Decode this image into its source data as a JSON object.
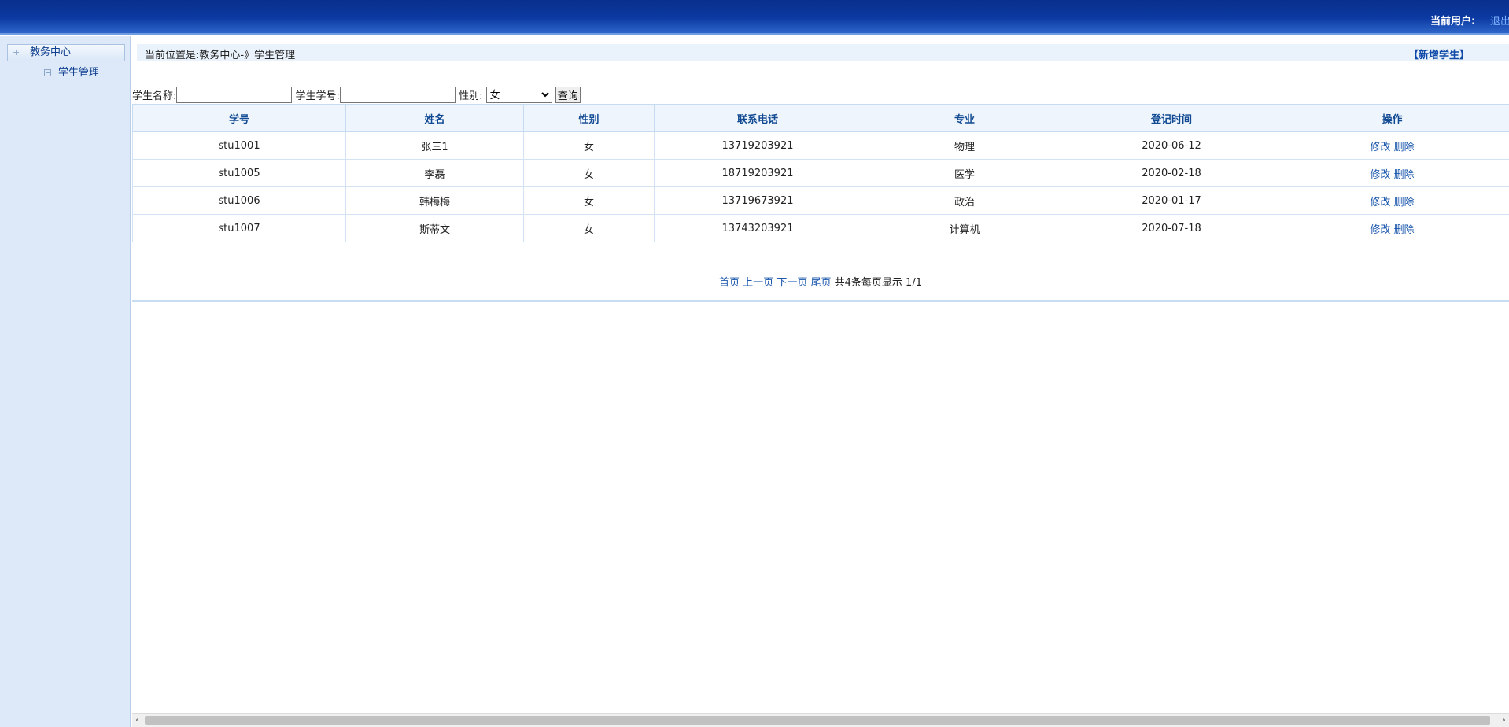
{
  "header": {
    "user_label": "当前用户:",
    "logout": "退出"
  },
  "sidebar": {
    "section": "教务中心",
    "items": [
      {
        "label": "学生管理"
      }
    ]
  },
  "breadcrumb": {
    "text": "当前位置是:教务中心-》学生管理",
    "new_link": "【新增学生】"
  },
  "search": {
    "name_label": "学生名称:",
    "name_value": "",
    "id_label": "学生学号:",
    "id_value": "",
    "gender_label": "性别:",
    "gender_selected": "女",
    "query_button": "查询"
  },
  "table": {
    "columns": [
      "学号",
      "姓名",
      "性别",
      "联系电话",
      "专业",
      "登记时间",
      "操作"
    ],
    "rows": [
      {
        "id": "stu1001",
        "name": "张三1",
        "gender": "女",
        "phone": "13719203921",
        "major": "物理",
        "date": "2020-06-12"
      },
      {
        "id": "stu1005",
        "name": "李磊",
        "gender": "女",
        "phone": "18719203921",
        "major": "医学",
        "date": "2020-02-18"
      },
      {
        "id": "stu1006",
        "name": "韩梅梅",
        "gender": "女",
        "phone": "13719673921",
        "major": "政治",
        "date": "2020-01-17"
      },
      {
        "id": "stu1007",
        "name": "斯蒂文",
        "gender": "女",
        "phone": "13743203921",
        "major": "计算机",
        "date": "2020-07-18"
      }
    ],
    "edit_label": "修改",
    "delete_label": "删除"
  },
  "pager": {
    "first": "首页",
    "prev": "上一页",
    "next": "下一页",
    "last": "尾页",
    "summary": "共4条每页显示 1/1"
  },
  "scrollbar": {
    "left_arrow": "‹",
    "right_arrow": "›"
  }
}
